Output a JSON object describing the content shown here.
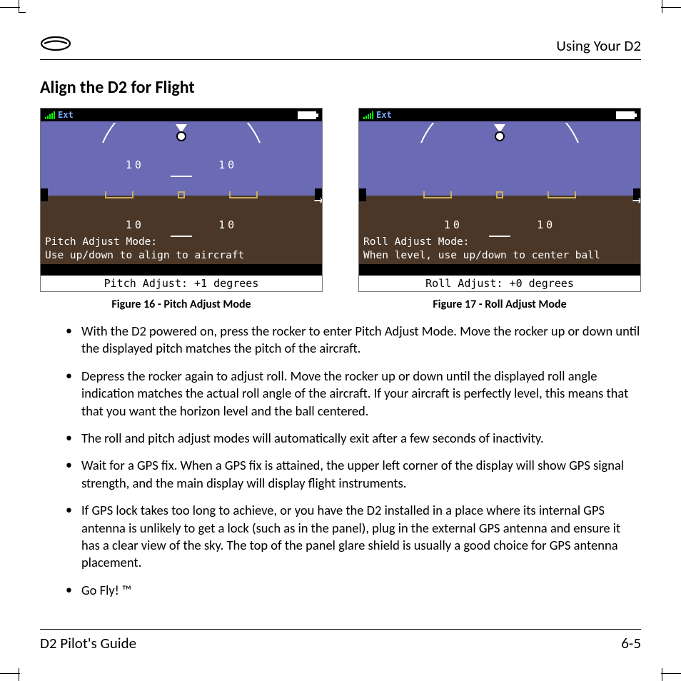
{
  "header": {
    "right": "Using Your D2"
  },
  "section_title": "Align the D2 for Flight",
  "figure_left": {
    "ext_label": "Ext",
    "scale_left": "10",
    "scale_right": "10",
    "mode_line1": "Pitch Adjust Mode:",
    "mode_line2": "Use up/down to align to aircraft",
    "footer": "Pitch Adjust:  +1 degrees",
    "caption": "Figure 16 - Pitch Adjust Mode"
  },
  "figure_right": {
    "ext_label": "Ext",
    "scale_left": "10",
    "scale_right": "10",
    "mode_line1": "Roll Adjust Mode:",
    "mode_line2": "When level, use up/down to center ball",
    "footer": "Roll Adjust:  +0 degrees",
    "caption": "Figure 17 - Roll Adjust Mode"
  },
  "bullets": [
    "With the D2 powered on, press the rocker to enter Pitch Adjust Mode. Move the rocker up or down until the displayed pitch matches the pitch of the aircraft.",
    "Depress the rocker again to adjust roll. Move the rocker up or down until the displayed roll angle indication matches the actual roll angle of the aircraft. If your aircraft is perfectly level, this means that that you want the horizon level and the ball centered.",
    "The roll and pitch adjust modes will automatically exit after a few seconds of inactivity.",
    "Wait for a GPS fix. When a GPS fix is attained, the upper left corner of the display will show GPS signal strength, and the main display will display flight instruments.",
    "If GPS lock takes too long to achieve, or you have the D2 installed in a place where its internal GPS antenna is unlikely to get a lock (such as in the panel), plug in the external GPS antenna and ensure it has a clear view of the sky. The top of the panel glare shield is usually a good choice for GPS antenna placement.",
    "Go Fly! ™"
  ],
  "footer": {
    "left": "D2 Pilot's Guide",
    "right": "6-5"
  }
}
